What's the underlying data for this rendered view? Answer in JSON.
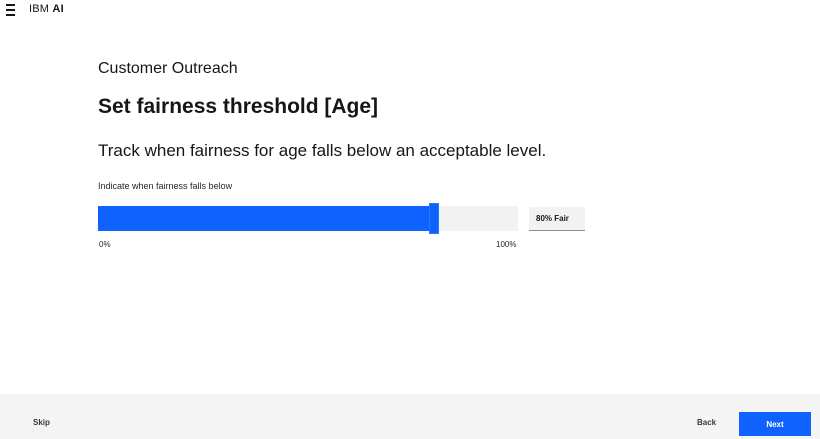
{
  "header": {
    "brand_prefix": "IBM",
    "brand_name": "AI",
    "menu_icon": "hamburger-menu-icon"
  },
  "page": {
    "breadcrumb": "Customer Outreach",
    "title": "Set fairness threshold [Age]",
    "description": "Track when fairness for age falls below an acceptable level."
  },
  "slider": {
    "label": "Indicate when fairness falls below",
    "min_label": "0%",
    "max_label": "100%",
    "value_percent": 80,
    "value_text": "80% Fair",
    "fill_color": "#0f62fe",
    "track_color": "#f2f2f2"
  },
  "footer": {
    "skip_label": "Skip",
    "back_label": "Back",
    "next_label": "Next",
    "next_color": "#0f62fe"
  }
}
